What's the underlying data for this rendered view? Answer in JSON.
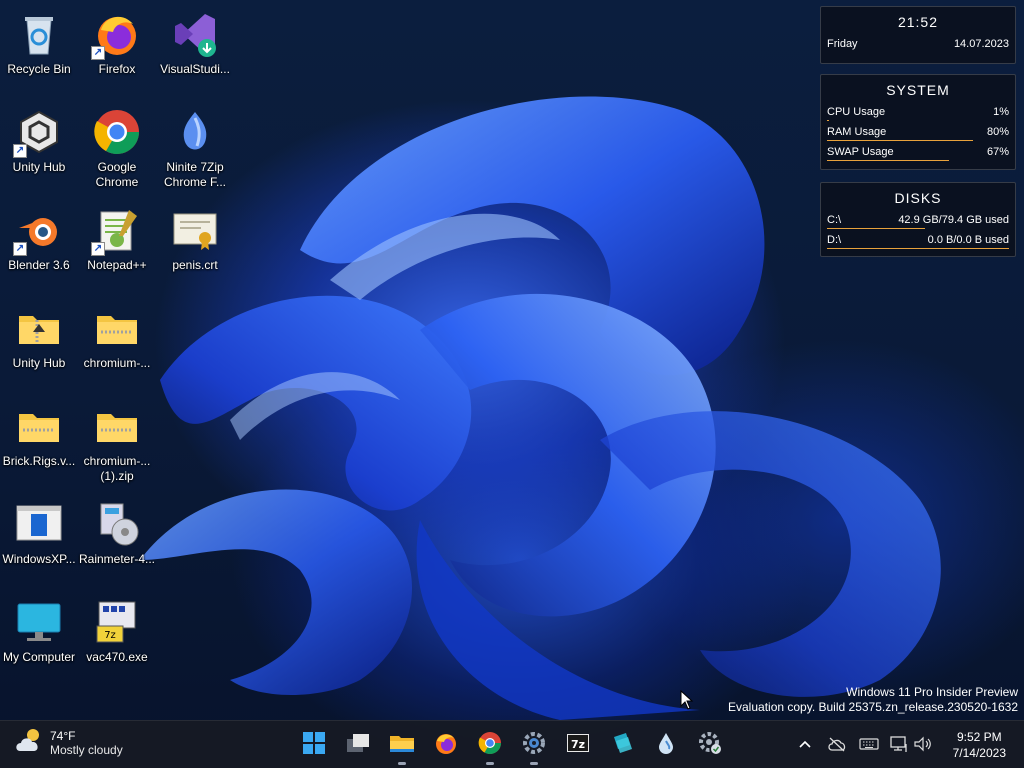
{
  "desktop_icons": [
    {
      "label": "Recycle Bin",
      "icon": "recycle-bin-icon"
    },
    {
      "label": "Firefox",
      "icon": "firefox-icon"
    },
    {
      "label": "VisualStudi...",
      "icon": "visual-studio-icon"
    },
    {
      "label": "Unity Hub",
      "icon": "unity-hub-icon"
    },
    {
      "label": "Google Chrome",
      "icon": "chrome-icon"
    },
    {
      "label": "Ninite 7Zip Chrome F...",
      "icon": "ninite-icon"
    },
    {
      "label": "Blender 3.6",
      "icon": "blender-icon"
    },
    {
      "label": "Notepad++",
      "icon": "notepad-plus-plus-icon"
    },
    {
      "label": "penis.crt",
      "icon": "certificate-icon"
    },
    {
      "label": "Unity Hub",
      "icon": "zip-folder-icon"
    },
    {
      "label": "chromium-...",
      "icon": "zip-folder-icon"
    },
    {
      "label": "Brick.Rigs.v...",
      "icon": "zip-folder-icon"
    },
    {
      "label": "chromium-... (1).zip",
      "icon": "zip-folder-icon"
    },
    {
      "label": "WindowsXP...",
      "icon": "window-app-icon"
    },
    {
      "label": "Rainmeter-4...",
      "icon": "installer-icon"
    },
    {
      "label": "My Computer",
      "icon": "monitor-icon"
    },
    {
      "label": "vac470.exe",
      "icon": "setup-exe-icon"
    }
  ],
  "widgets": {
    "clock": {
      "time": "21:52",
      "day": "Friday",
      "date": "14.07.2023"
    },
    "system": {
      "title": "SYSTEM",
      "rows": [
        {
          "label": "CPU Usage",
          "value": "1%",
          "fraction": 0.01
        },
        {
          "label": "RAM Usage",
          "value": "80%",
          "fraction": 0.8
        },
        {
          "label": "SWAP Usage",
          "value": "67%",
          "fraction": 0.67
        }
      ]
    },
    "disks": {
      "title": "DISKS",
      "rows": [
        {
          "label": "C:\\",
          "value": "42.9 GB/79.4 GB used",
          "fraction": 0.54
        },
        {
          "label": "D:\\",
          "value": "0.0 B/0.0 B used",
          "fraction": 1.0
        }
      ]
    },
    "accent": "#e8a23c"
  },
  "watermark": {
    "line1": "Windows 11 Pro Insider Preview",
    "line2": "Evaluation copy. Build 25375.zn_release.230520-1632"
  },
  "taskbar": {
    "weather": {
      "temp": "74°F",
      "condition": "Mostly cloudy"
    },
    "apps": [
      {
        "name": "start-button",
        "icon": "windows-logo-icon",
        "running": false
      },
      {
        "name": "task-view-button",
        "icon": "task-view-icon",
        "running": false
      },
      {
        "name": "file-explorer-button",
        "icon": "folder-icon",
        "running": true
      },
      {
        "name": "firefox-button",
        "icon": "firefox-icon",
        "running": false
      },
      {
        "name": "chrome-button",
        "icon": "chrome-icon",
        "running": true
      },
      {
        "name": "settings-button",
        "icon": "settings-gear-icon",
        "running": true
      },
      {
        "name": "7zip-button",
        "icon": "7zip-icon",
        "running": false
      },
      {
        "name": "app-button",
        "icon": "teal-app-icon",
        "running": false
      },
      {
        "name": "rainmeter-button",
        "icon": "rainmeter-drop-icon",
        "running": false
      },
      {
        "name": "control-button",
        "icon": "gear-check-icon",
        "running": false
      }
    ],
    "clock": {
      "time": "9:52 PM",
      "date": "7/14/2023"
    }
  }
}
